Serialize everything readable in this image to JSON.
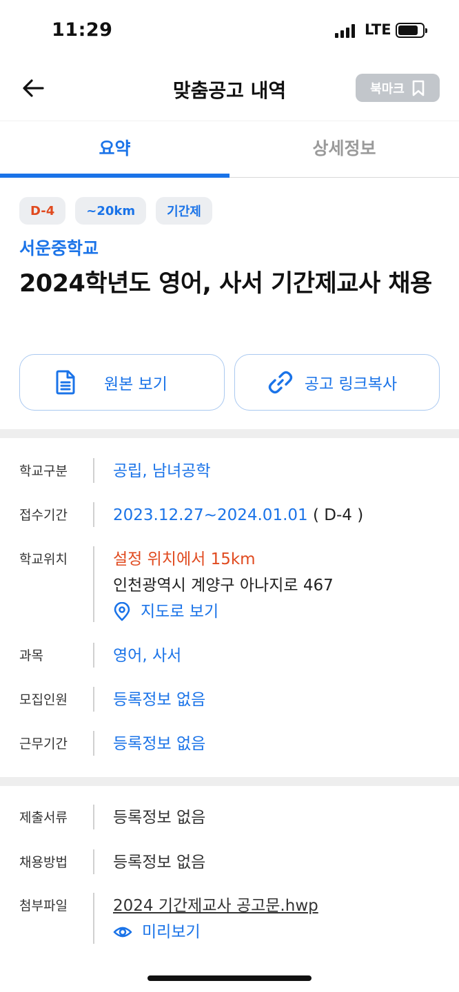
{
  "status_bar": {
    "time": "11:29",
    "network": "LTE"
  },
  "header": {
    "title": "맞춤공고 내역",
    "bookmark_label": "북마크"
  },
  "tabs": [
    {
      "label": "요약",
      "active": true
    },
    {
      "label": "상세정보",
      "active": false
    }
  ],
  "chips": [
    {
      "label": "D-4",
      "color": "#e04a1f"
    },
    {
      "label": "~20km",
      "color": "#1a73e8"
    },
    {
      "label": "기간제",
      "color": "#1a73e8"
    }
  ],
  "school": "서운중학교",
  "title": "2024학년도 영어, 사서 기간제교사 채용",
  "actions": {
    "view_original": "원본 보기",
    "copy_link": "공고 링크복사"
  },
  "info": {
    "school_type": {
      "label": "학교구분",
      "value": "공립, 남녀공학"
    },
    "period": {
      "label": "접수기간",
      "value": "2023.12.27~2024.01.01",
      "suffix": " ( D-4 )"
    },
    "location": {
      "label": "학교위치",
      "distance": "설정 위치에서 15km",
      "address": "인천광역시 계양구 아나지로 467",
      "map_link": "지도로 보기"
    },
    "subject": {
      "label": "과목",
      "value": "영어, 사서"
    },
    "recruit": {
      "label": "모집인원",
      "value": "등록정보 없음"
    },
    "work_period": {
      "label": "근무기간",
      "value": "등록정보 없음"
    }
  },
  "info2": {
    "documents": {
      "label": "제출서류",
      "value": "등록정보 없음"
    },
    "method": {
      "label": "채용방법",
      "value": "등록정보 없음"
    },
    "attachment": {
      "label": "첨부파일",
      "file": "2024 기간제교사 공고문.hwp",
      "preview": "미리보기"
    }
  },
  "colors": {
    "accent": "#1a73e8",
    "alert": "#e04a1f"
  }
}
